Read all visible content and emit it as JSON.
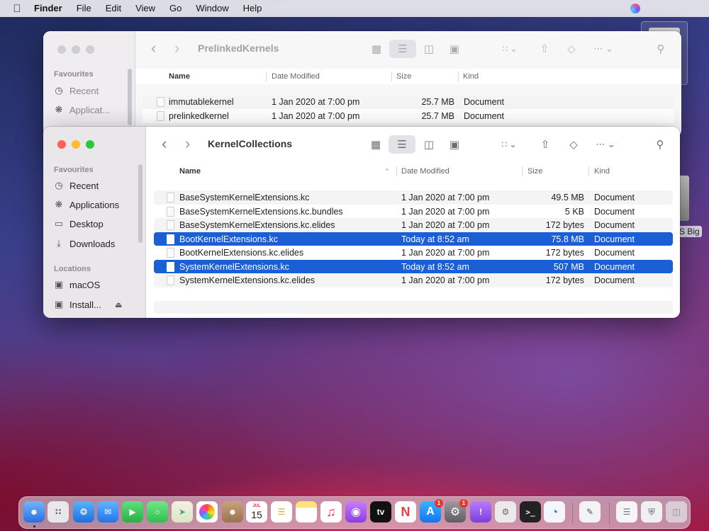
{
  "menubar": {
    "app_name": "Finder",
    "items": [
      "File",
      "Edit",
      "View",
      "Go",
      "Window",
      "Help"
    ]
  },
  "desktop": {
    "drive_label": "S Big"
  },
  "back_window": {
    "title": "PrelinkedKernels",
    "sidebar": {
      "section_favourites": "Favourites",
      "items": [
        {
          "icon": "clock-icon",
          "label": "Recent"
        },
        {
          "icon": "applications-icon",
          "label": "Applicat..."
        }
      ]
    },
    "columns": {
      "name": "Name",
      "date": "Date Modified",
      "size": "Size",
      "kind": "Kind"
    },
    "rows": [
      {
        "name": "immutablekernel",
        "date": "1 Jan 2020 at 7:00 pm",
        "size": "25.7 MB",
        "kind": "Document"
      },
      {
        "name": "prelinkedkernel",
        "date": "1 Jan 2020 at 7:00 pm",
        "size": "25.7 MB",
        "kind": "Document"
      }
    ]
  },
  "front_window": {
    "title": "KernelCollections",
    "sidebar": {
      "section_favourites": "Favourites",
      "favourites": [
        {
          "icon": "clock-icon",
          "label": "Recent"
        },
        {
          "icon": "applications-icon",
          "label": "Applications"
        },
        {
          "icon": "desktop-icon",
          "label": "Desktop"
        },
        {
          "icon": "downloads-icon",
          "label": "Downloads"
        }
      ],
      "section_locations": "Locations",
      "locations": [
        {
          "icon": "disk-icon",
          "label": "macOS"
        },
        {
          "icon": "disk-icon",
          "label": "Install..."
        }
      ]
    },
    "columns": {
      "name": "Name",
      "date": "Date Modified",
      "size": "Size",
      "kind": "Kind"
    },
    "rows": [
      {
        "name": "BaseSystemKernelExtensions.kc",
        "date": "1 Jan 2020 at 7:00 pm",
        "size": "49.5 MB",
        "kind": "Document",
        "selected": false
      },
      {
        "name": "BaseSystemKernelExtensions.kc.bundles",
        "date": "1 Jan 2020 at 7:00 pm",
        "size": "5 KB",
        "kind": "Document",
        "selected": false
      },
      {
        "name": "BaseSystemKernelExtensions.kc.elides",
        "date": "1 Jan 2020 at 7:00 pm",
        "size": "172 bytes",
        "kind": "Document",
        "selected": false
      },
      {
        "name": "BootKernelExtensions.kc",
        "date": "Today at 8:52 am",
        "size": "75.8 MB",
        "kind": "Document",
        "selected": true
      },
      {
        "name": "BootKernelExtensions.kc.elides",
        "date": "1 Jan 2020 at 7:00 pm",
        "size": "172 bytes",
        "kind": "Document",
        "selected": false
      },
      {
        "name": "SystemKernelExtensions.kc",
        "date": "Today at 8:52 am",
        "size": "507 MB",
        "kind": "Document",
        "selected": true
      },
      {
        "name": "SystemKernelExtensions.kc.elides",
        "date": "1 Jan 2020 at 7:00 pm",
        "size": "172 bytes",
        "kind": "Document",
        "selected": false
      }
    ]
  },
  "dock": {
    "calendar_month": "JUL",
    "calendar_day": "15",
    "tv_label": "tv",
    "badge_count": "1",
    "colors": {
      "finder": "#3d8bff",
      "safari": "#1d7cf2",
      "mail": "#2c8df5",
      "facetime": "#34c759",
      "messages": "#30c352",
      "music": "#fa2d55",
      "podcasts": "#a54de8",
      "news": "#f43b4e",
      "appstore": "#1b8cf6",
      "selection": "#1a5fd6"
    }
  }
}
